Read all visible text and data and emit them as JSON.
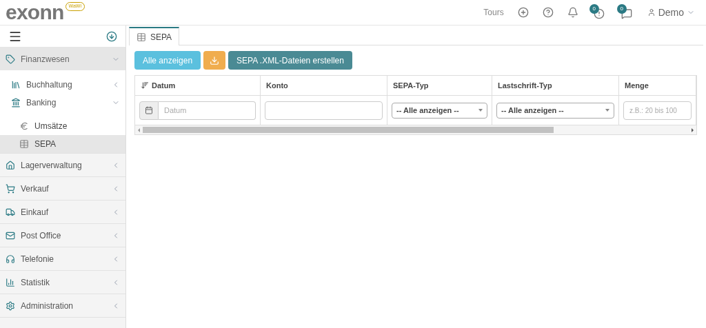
{
  "header": {
    "logo": "exonn",
    "logo_badge": "WaWi",
    "tours": "Tours",
    "alerts_count": "0",
    "messages_count": "0",
    "user": "Demo"
  },
  "sidebar": {
    "items": [
      {
        "label": "Finanzwesen",
        "expanded": true,
        "children": [
          {
            "label": "Buchhaltung",
            "expanded": false
          },
          {
            "label": "Banking",
            "expanded": true,
            "children": [
              {
                "label": "Umsätze",
                "selected": false
              },
              {
                "label": "SEPA",
                "selected": true
              }
            ]
          }
        ]
      },
      {
        "label": "Lagerverwaltung",
        "expanded": false
      },
      {
        "label": "Verkauf",
        "expanded": false
      },
      {
        "label": "Einkauf",
        "expanded": false
      },
      {
        "label": "Post Office",
        "expanded": false
      },
      {
        "label": "Telefonie",
        "expanded": false
      },
      {
        "label": "Statistik",
        "expanded": false
      },
      {
        "label": "Administration",
        "expanded": false
      }
    ]
  },
  "tabs": [
    {
      "label": "SEPA",
      "selected": true
    }
  ],
  "toolbar": {
    "show_all": "Alle anzeigen",
    "create": "SEPA .XML-Dateien erstellen"
  },
  "table": {
    "columns": [
      {
        "label": "Datum",
        "sorted": true,
        "filter": {
          "kind": "date",
          "placeholder": "Datum"
        }
      },
      {
        "label": "Konto",
        "sorted": false,
        "filter": {
          "kind": "text"
        }
      },
      {
        "label": "SEPA-Typ",
        "sorted": false,
        "filter": {
          "kind": "select",
          "value": "-- Alle anzeigen --"
        }
      },
      {
        "label": "Lastschrift-Typ",
        "sorted": false,
        "filter": {
          "kind": "select",
          "value": "-- Alle anzeigen --"
        }
      },
      {
        "label": "Menge",
        "sorted": false,
        "filter": {
          "kind": "text",
          "placeholder": "z.B.: 20 bis 100"
        }
      }
    ]
  }
}
